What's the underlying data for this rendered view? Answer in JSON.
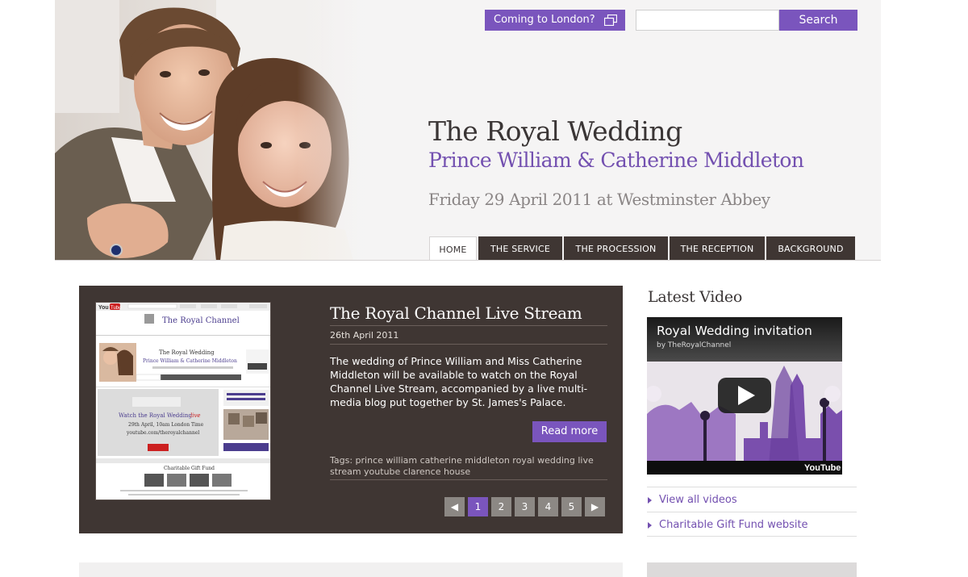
{
  "header": {
    "coming_button": "Coming to London?",
    "search_placeholder": "",
    "search_button": "Search",
    "title": "The Royal Wedding",
    "subtitle": "Prince William & Catherine Middleton",
    "date": "Friday 29 April 2011 at Westminster Abbey"
  },
  "nav": {
    "items": [
      {
        "label": "HOME",
        "active": true
      },
      {
        "label": "THE SERVICE"
      },
      {
        "label": "THE PROCESSION"
      },
      {
        "label": "THE RECEPTION"
      },
      {
        "label": "BACKGROUND"
      }
    ]
  },
  "feature": {
    "title": "The Royal Channel Live Stream",
    "date": "26th April 2011",
    "body": "The wedding of Prince William and Miss Catherine Middleton will be available to watch on the Royal Channel Live Stream, accompanied by a live multi-media blog put together by St. James's Palace.",
    "read_more": "Read more",
    "tags": "Tags: prince william catherine middleton royal wedding live stream youtube clarence house",
    "thumb": {
      "brand": "You",
      "brand2": "Tube",
      "channel": "The Royal Channel",
      "mini_title": "The Royal Wedding",
      "mini_sub": "Prince William & Catherine Middleton",
      "watch": "Watch the Royal Wedding",
      "watch_live": "live",
      "watch_time": "29th April, 10am London Time",
      "watch_url": "youtube.com/theroyalchannel",
      "gift": "Charitable Gift Fund"
    },
    "pager": {
      "prev": "◀",
      "next": "▶",
      "pages": [
        "1",
        "2",
        "3",
        "4",
        "5"
      ],
      "active": "1"
    }
  },
  "sidebar": {
    "latest_video_title": "Latest Video",
    "video_title": "Royal Wedding invitation",
    "video_by": "by TheRoyalChannel",
    "video_brand": "YouTube",
    "links": [
      "View all videos",
      "Charitable Gift Fund website"
    ]
  },
  "colors": {
    "accent": "#7a55bd",
    "dark_panel": "#3f3633",
    "title_text": "#3a3535"
  }
}
